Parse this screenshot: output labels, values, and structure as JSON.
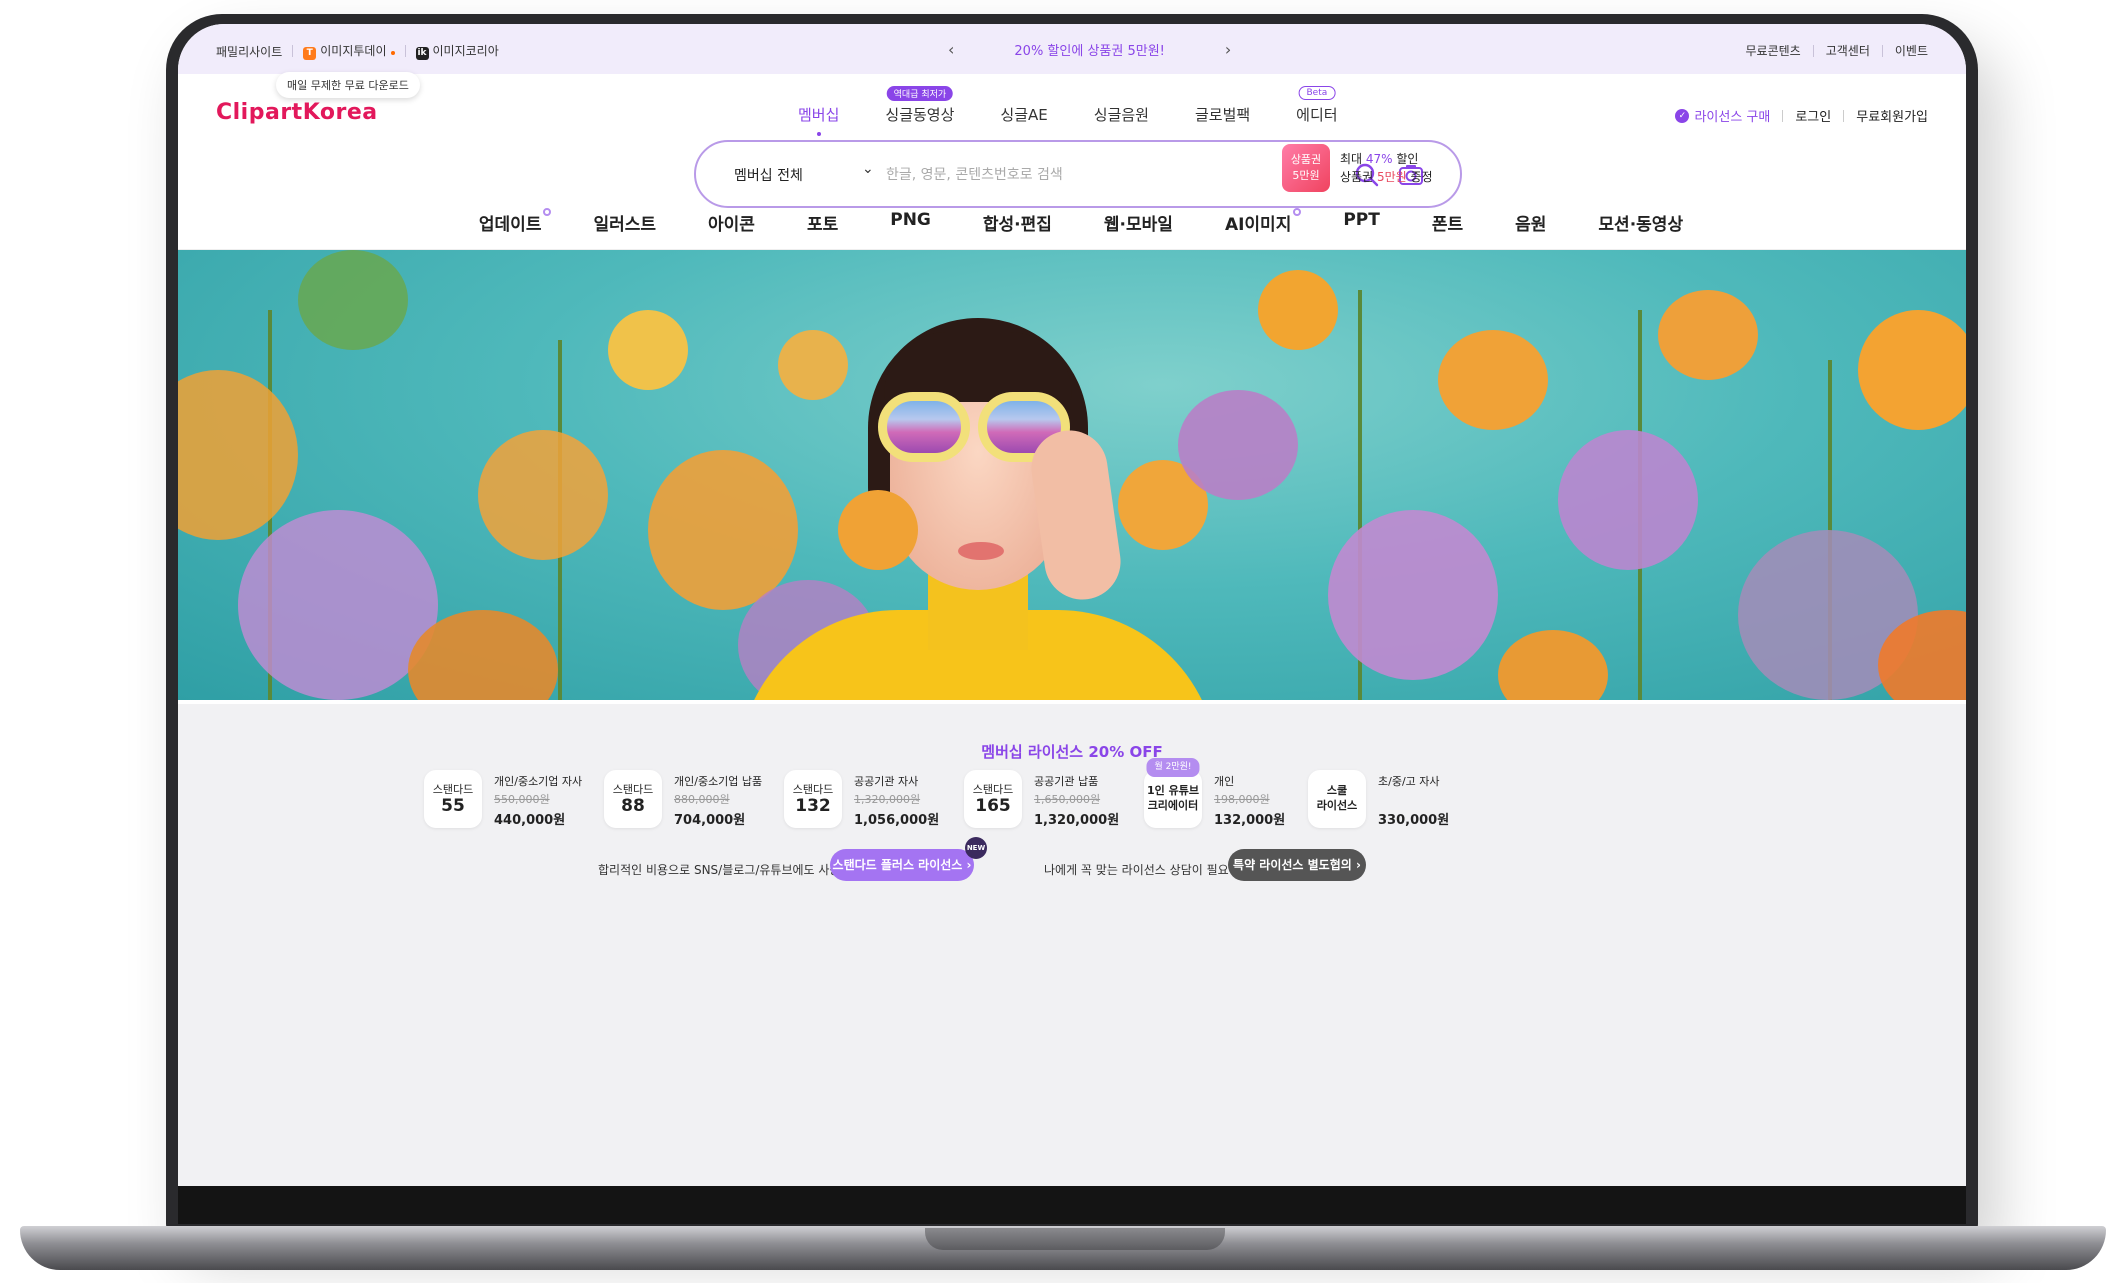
{
  "topbar": {
    "family_sites": "패밀리사이트",
    "imagetoday": "이미지투데이",
    "imagekorea": "이미지코리아",
    "tooltip": "매일 무제한 무료 다운로드",
    "promo": "20% 할인에 상품권 5만원!",
    "prev": "‹",
    "next": "›",
    "free_content": "무료콘텐츠",
    "support": "고객센터",
    "event": "이벤트"
  },
  "header": {
    "logo": "ClipartKorea",
    "nav": [
      {
        "label": "멤버십",
        "badge": ""
      },
      {
        "label": "싱글동영상",
        "badge": "역대급 최저가"
      },
      {
        "label": "싱글AE",
        "badge": ""
      },
      {
        "label": "싱글음원",
        "badge": ""
      },
      {
        "label": "글로벌팩",
        "badge": ""
      },
      {
        "label": "에디터",
        "badge": "Beta"
      }
    ],
    "license_buy": "라이선스 구매",
    "login": "로그인",
    "signup": "무료회원가입"
  },
  "search": {
    "scope": "멤버십 전체",
    "placeholder": "한글, 영문, 콘텐츠번호로 검색",
    "promo_badge_line1": "상품권",
    "promo_badge_line2": "5만원",
    "promo_line1_a": "최대 ",
    "promo_line1_b": "47%",
    "promo_line1_c": " 할인",
    "promo_line2_a": "상품권 ",
    "promo_line2_b": "5만원",
    "promo_line2_c": " 증정"
  },
  "categories": [
    "업데이트",
    "일러스트",
    "아이콘",
    "포토",
    "PNG",
    "합성·편집",
    "웹·모바일",
    "AI이미지",
    "PPT",
    "폰트",
    "음원",
    "모션·동영상"
  ],
  "license": {
    "title": "멤버십 라이선스 20% OFF",
    "plans": [
      {
        "name": "스탠다드",
        "num": "55",
        "desc": "개인/중소기업 자사",
        "orig": "550,000원",
        "price": "440,000원"
      },
      {
        "name": "스탠다드",
        "num": "88",
        "desc": "개인/중소기업 납품",
        "orig": "880,000원",
        "price": "704,000원"
      },
      {
        "name": "스탠다드",
        "num": "132",
        "desc": "공공기관 자사",
        "orig": "1,320,000원",
        "price": "1,056,000원"
      },
      {
        "name": "스탠다드",
        "num": "165",
        "desc": "공공기관 납품",
        "orig": "1,650,000원",
        "price": "1,320,000원"
      },
      {
        "name": "1인 유튜브",
        "num": "크리에이터",
        "badge": "월 2만원!",
        "desc": "개인",
        "orig": "198,000원",
        "price": "132,000원"
      },
      {
        "name": "스쿨",
        "num": "라이선스",
        "desc": "초/중/고 자사",
        "orig": "",
        "price": "330,000원"
      }
    ],
    "cta1_text": "합리적인 비용으로 SNS/블로그/유튜브에도 사용하세요!",
    "cta1_button": "스탠다드 플러스 라이선스 ›",
    "new_badge": "NEW",
    "cta2_text": "나에게 꼭 맞는 라이선스 상담이 필요하다면?",
    "cta2_button": "특약 라이선스 별도협의 ›"
  },
  "colors": {
    "accent": "#8a45e8",
    "brand": "#e2185b"
  }
}
